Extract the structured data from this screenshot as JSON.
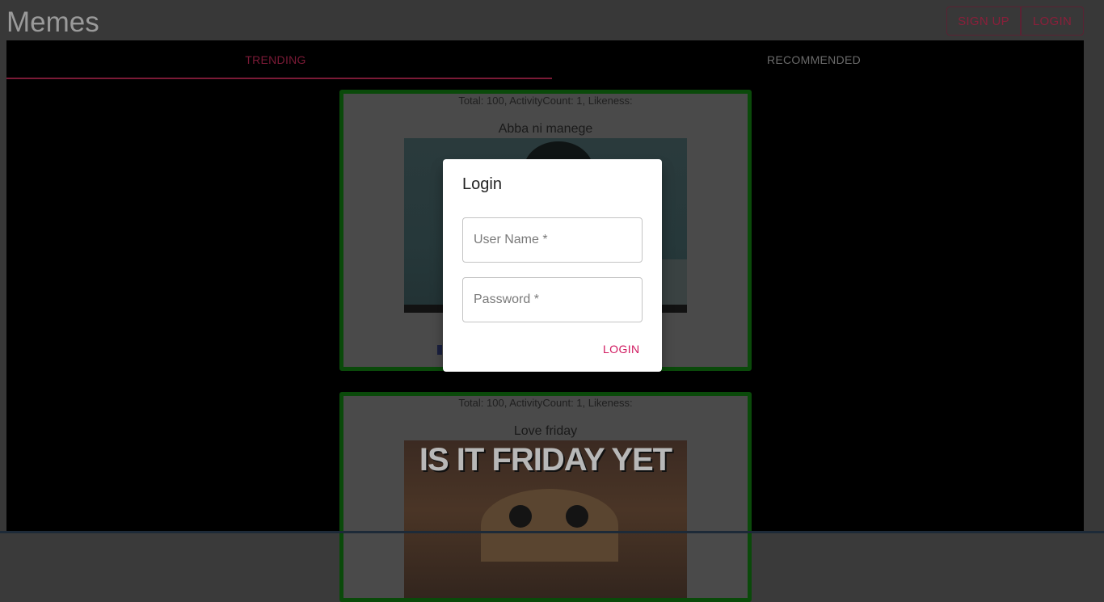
{
  "app": {
    "title": "Memes"
  },
  "header": {
    "signup_label": "SIGN UP",
    "login_label": "LOGIN"
  },
  "tabs": [
    {
      "label": "TRENDING",
      "active": true
    },
    {
      "label": "RECOMMENDED",
      "active": false
    }
  ],
  "memes": [
    {
      "stats": "Total: 100, ActivityCount: 1, Likeness:",
      "title": "Abba ni manege"
    },
    {
      "stats": "Total: 100, ActivityCount: 1, Likeness:",
      "title": "Love friday",
      "image_caption": "IS IT FRIDAY YET"
    }
  ],
  "dialog": {
    "title": "Login",
    "username_placeholder": "User Name *",
    "password_placeholder": "Password *",
    "login_label": "LOGIN"
  },
  "colors": {
    "accent": "#d0185f",
    "card_border": "#0a9a0a",
    "panel_background": "#000000"
  }
}
